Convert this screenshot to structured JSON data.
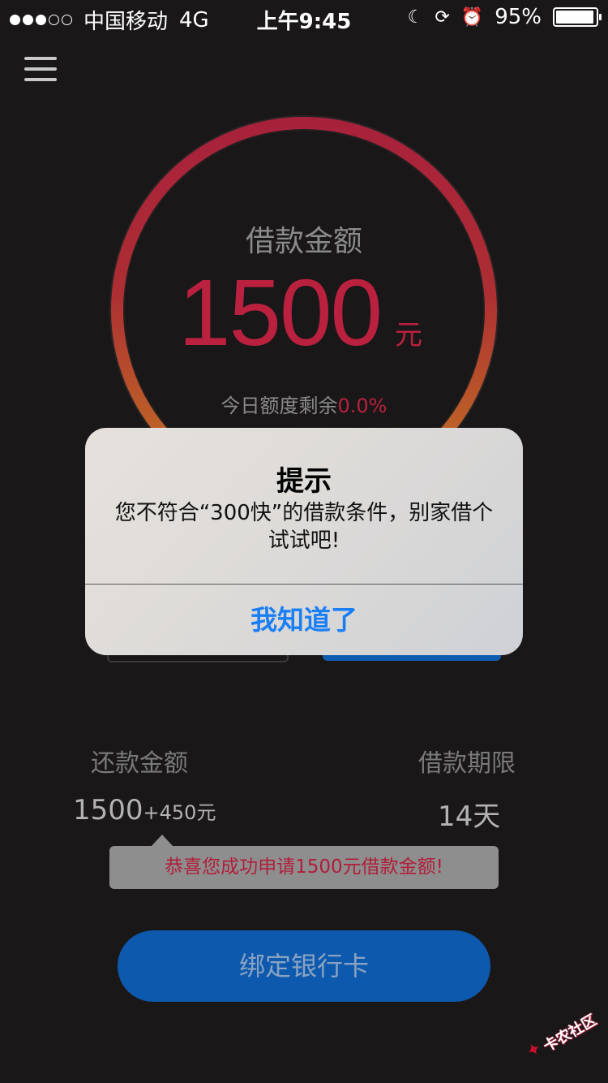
{
  "status_bar": {
    "signal_dots_filled": 3,
    "signal_dots_total": 5,
    "carrier": "中国移动",
    "network": "4G",
    "time": "上午9:45",
    "battery_percent": "95%",
    "battery_level": 0.95,
    "icons": [
      "moon-icon",
      "rotation-lock-icon",
      "alarm-icon"
    ]
  },
  "header": {
    "menu_icon": "hamburger-menu-icon"
  },
  "loan": {
    "label": "借款金额",
    "amount": "1500",
    "unit": "元",
    "quota_label": "今日额度剩余",
    "quota_value": "0.0%"
  },
  "alert": {
    "title": "提示",
    "message": "您不符合“300快”的借款条件，别家借个试试吧!",
    "button": "我知道了"
  },
  "repay": {
    "amount_label": "还款金额",
    "amount_base": "1500",
    "amount_extra": "+450元",
    "term_label": "借款期限",
    "term_value": "14天"
  },
  "tooltip": {
    "text": "恭喜您成功申请1500元借款金额!"
  },
  "bind_button": {
    "label": "绑定银行卡"
  },
  "watermark": {
    "text": "卡农社区"
  },
  "colors": {
    "background": "#1a1718",
    "accent_red": "#b9213f",
    "ring_top": "#a8213b",
    "ring_bottom": "#c47a22",
    "button_blue": "#0d59ad",
    "alert_blue": "#1a7ff5"
  }
}
